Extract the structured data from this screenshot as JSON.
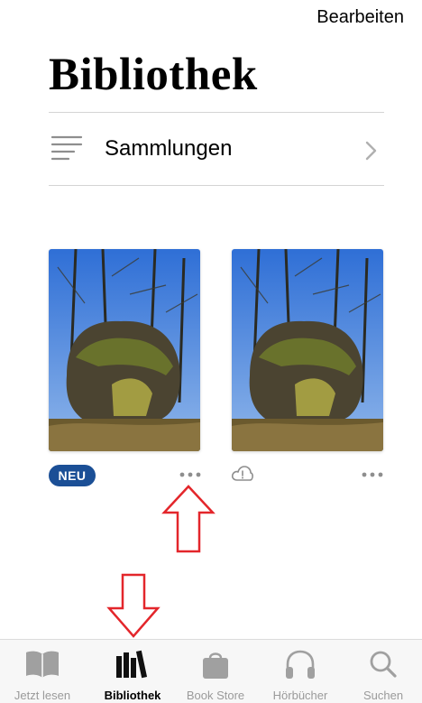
{
  "header": {
    "edit_label": "Bearbeiten",
    "title": "Bibliothek"
  },
  "collections": {
    "label": "Sammlungen",
    "icon": "list-icon"
  },
  "books": [
    {
      "badge": "NEU",
      "status_icon": "",
      "more_icon": "ellipsis-icon"
    },
    {
      "badge": "",
      "status_icon": "cloud-warning-icon",
      "more_icon": "ellipsis-icon"
    }
  ],
  "annotations": {
    "arrow_up_color": "#e3262b",
    "arrow_down_color": "#e3262b"
  },
  "tabbar": {
    "tabs": [
      {
        "label": "Jetzt lesen",
        "icon": "open-book-icon",
        "active": false
      },
      {
        "label": "Bibliothek",
        "icon": "library-books-icon",
        "active": true
      },
      {
        "label": "Book Store",
        "icon": "shopping-bag-icon",
        "active": false
      },
      {
        "label": "Hörbücher",
        "icon": "headphones-icon",
        "active": false
      },
      {
        "label": "Suchen",
        "icon": "search-icon",
        "active": false
      }
    ]
  },
  "colors": {
    "badge_bg": "#1b4f96",
    "inactive_tab": "#9a9a9a",
    "active_tab": "#000000",
    "annotation_red": "#e3262b"
  }
}
